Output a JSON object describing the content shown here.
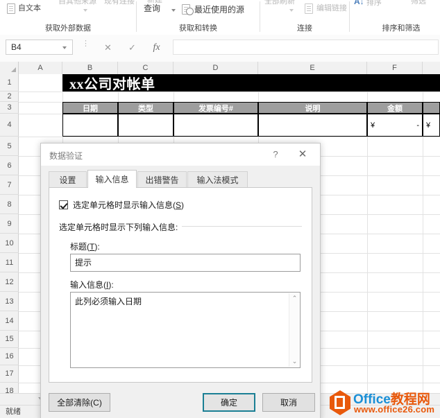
{
  "ribbon": {
    "groups": [
      {
        "label": "获取外部数据",
        "buttons": [
          {
            "label": "自文本",
            "icon": "document-icon"
          },
          {
            "label": "自其他来源",
            "icon": "other-sources-icon"
          },
          {
            "label": "现有连接",
            "icon": "existing-connection-icon"
          }
        ]
      },
      {
        "label": "获取和转换",
        "buttons": [
          {
            "label": "新建",
            "label2": "查询",
            "icon": "new-query-icon"
          },
          {
            "label": "最近使用的源",
            "icon": "recent-sources-icon"
          }
        ]
      },
      {
        "label": "连接",
        "buttons": [
          {
            "label": "全部刷新",
            "icon": "refresh-all-icon"
          },
          {
            "label": "编辑链接",
            "icon": "edit-links-icon"
          }
        ]
      },
      {
        "label": "排序和筛选",
        "buttons": [
          {
            "label": "排序",
            "icon": "sort-za-icon"
          },
          {
            "label": "筛选",
            "icon": "filter-icon"
          }
        ]
      }
    ]
  },
  "formula_bar": {
    "name_box_value": "B4",
    "cancel_icon": "✕",
    "confirm_icon": "✓",
    "function_icon": "fx",
    "formula_value": ""
  },
  "grid": {
    "columns": [
      "A",
      "B",
      "C",
      "D",
      "E",
      "F"
    ],
    "rows": [
      "1",
      "2",
      "3",
      "4",
      "5",
      "6",
      "7",
      "8",
      "9",
      "10",
      "11",
      "12",
      "13",
      "14",
      "15",
      "16",
      "17",
      "18"
    ],
    "sheet_title": "xx公司对帐单",
    "table_headers": [
      "日期",
      "类型",
      "发票编号#",
      "说明",
      "金额"
    ],
    "amount_symbol": "¥",
    "amount_value": "-",
    "amount_symbol_g": "¥"
  },
  "status_bar": {
    "text": "就绪"
  },
  "dialog": {
    "title": "数据验证",
    "help_icon": "?",
    "close_icon": "✕",
    "tabs": [
      {
        "label": "设置",
        "active": false
      },
      {
        "label": "输入信息",
        "active": true
      },
      {
        "label": "出错警告",
        "active": false
      },
      {
        "label": "输入法模式",
        "active": false
      }
    ],
    "checkbox_label_pre": "选定单元格时显示输入信息(",
    "checkbox_accel": "S",
    "checkbox_label_post": ")",
    "checkbox_checked": true,
    "group_label": "选定单元格时显示下列输入信息:",
    "title_field": {
      "label_pre": "标题(",
      "label_accel": "T",
      "label_post": "):",
      "value": "提示"
    },
    "message_field": {
      "label_pre": "输入信息(",
      "label_accel": "I",
      "label_post": "):",
      "value": "此列必须输入日期",
      "scroll_up_icon": "⌃",
      "scroll_down_icon": "⌄"
    },
    "buttons": {
      "clear_all": "全部清除(C)",
      "ok": "确定",
      "cancel": "取消"
    },
    "accent_color": "#1a7f94"
  },
  "watermark": {
    "line1_a": "Office",
    "line1_b": "教程网",
    "line2": "www.office26.com",
    "orange": "#e8590c",
    "blue": "#1a8fd6"
  }
}
